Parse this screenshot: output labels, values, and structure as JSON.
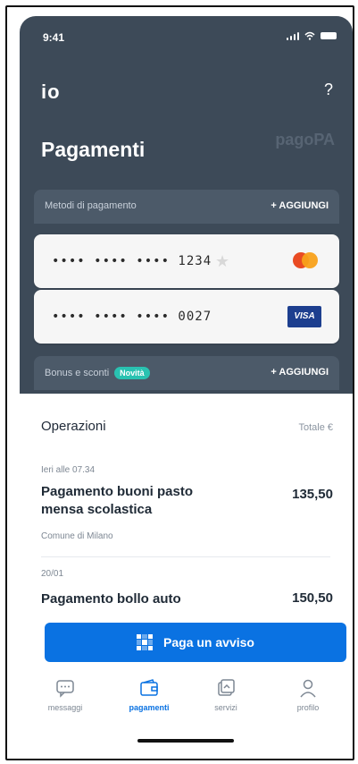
{
  "status": {
    "time": "9:41"
  },
  "header": {
    "logo": "io",
    "help_icon": "?",
    "title": "Pagamenti",
    "brand": "pagoPA"
  },
  "methods": {
    "label": "Metodi di pagamento",
    "add_label": "+ AGGIUNGI",
    "cards": [
      {
        "number": "•••• •••• •••• 1234",
        "brand": "mastercard"
      },
      {
        "number": "•••• •••• •••• 0027",
        "brand": "VISA"
      }
    ]
  },
  "bonus": {
    "label": "Bonus e sconti",
    "badge": "Novità",
    "add_label": "+ AGGIUNGI"
  },
  "operations": {
    "heading": "Operazioni",
    "total_label": "Totale €",
    "items": [
      {
        "date": "Ieri alle 07.34",
        "title": "Pagamento buoni pasto mensa scolastica",
        "amount": "135,50",
        "subtitle": "Comune di Milano"
      },
      {
        "date": "20/01",
        "title": "Pagamento bollo auto",
        "amount": "150,50"
      }
    ]
  },
  "pay_button": {
    "label": "Paga un avviso"
  },
  "tabs": [
    {
      "label": "messaggi",
      "icon": "message-icon"
    },
    {
      "label": "pagamenti",
      "icon": "wallet-icon"
    },
    {
      "label": "servizi",
      "icon": "services-icon"
    },
    {
      "label": "profilo",
      "icon": "profile-icon"
    }
  ],
  "colors": {
    "header_bg": "#3d4a58",
    "accent": "#0a72e2",
    "badge": "#29c2b1"
  }
}
